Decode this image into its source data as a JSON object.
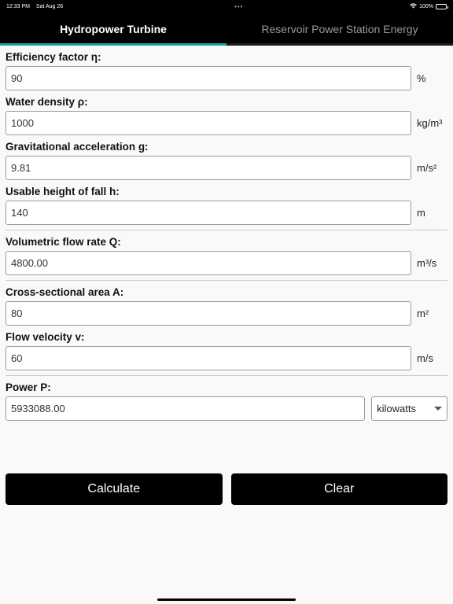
{
  "status_bar": {
    "time": "12:33 PM",
    "date": "Sat Aug 26",
    "dots": "•••",
    "battery": "100%"
  },
  "tabs": [
    {
      "label": "Hydropower Turbine",
      "active": true
    },
    {
      "label": "Reservoir Power Station Energy",
      "active": false
    }
  ],
  "colors": {
    "accent": "#17a2a0",
    "header_bg": "#000000",
    "button_bg": "#000000"
  },
  "fields": {
    "efficiency": {
      "label": "Efficiency factor η:",
      "value": "90",
      "unit": "%"
    },
    "density": {
      "label": "Water density ρ:",
      "value": "1000",
      "unit": "kg/m³"
    },
    "gravity": {
      "label": "Gravitational acceleration g:",
      "value": "9.81",
      "unit": "m/s²"
    },
    "height": {
      "label": "Usable height of fall h:",
      "value": "140",
      "unit": "m"
    },
    "flow_rate": {
      "label": "Volumetric flow rate Q:",
      "value": "4800.00",
      "unit": "m³/s"
    },
    "area": {
      "label": "Cross-sectional area A:",
      "value": "80",
      "unit": "m²"
    },
    "velocity": {
      "label": "Flow velocity v:",
      "value": "60",
      "unit": "m/s"
    },
    "power": {
      "label": "Power P:",
      "value": "5933088.00",
      "unit_selected": "kilowatts"
    }
  },
  "buttons": {
    "calculate": "Calculate",
    "clear": "Clear"
  }
}
